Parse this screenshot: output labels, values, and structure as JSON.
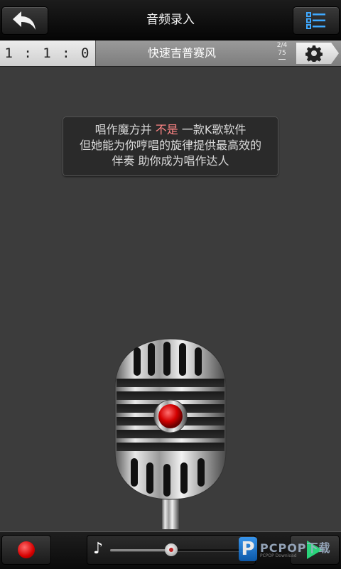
{
  "header": {
    "title": "音频录入",
    "back_icon": "back-arrow-icon",
    "menu_icon": "list-menu-icon"
  },
  "info_bar": {
    "time": "1 : 1 : 0",
    "style_name": "快速吉普赛风",
    "meter_top": "2/4",
    "meter_bottom": "75",
    "settings_icon": "gear-icon"
  },
  "message": {
    "line1_pre": "唱作魔方并 ",
    "line1_highlight": "不是",
    "line1_post": " 一款K歌软件",
    "line2": "但她能为你哼唱的旋律提供最高效的",
    "line3": "伴奏  助你成为唱作达人",
    "highlight_color": "#ff8585"
  },
  "bottom_bar": {
    "record_icon": "record-icon",
    "note_icon": "♪",
    "slider_value": 0.44,
    "play_icon": "play-icon"
  },
  "watermark": {
    "logo_letter": "P",
    "text": "PCPOP下载",
    "sub": "PCPOP Download"
  }
}
